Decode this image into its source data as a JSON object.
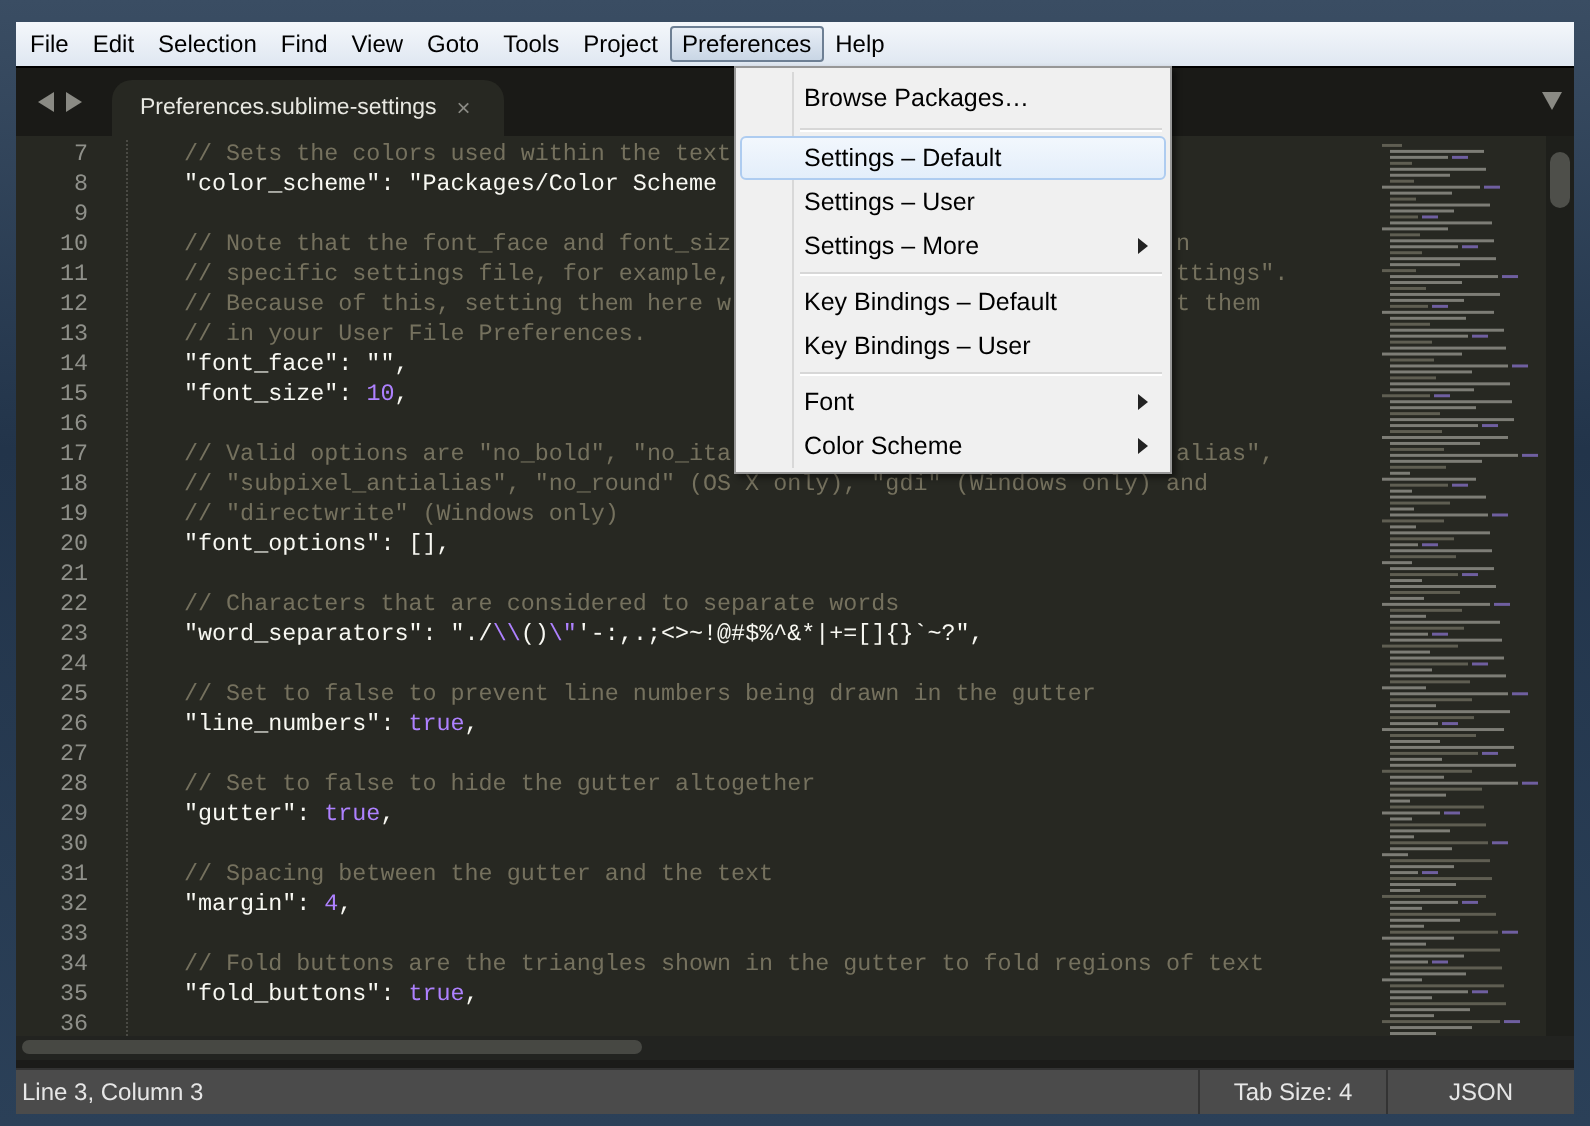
{
  "menu_bar": [
    {
      "label": "File",
      "selected": false
    },
    {
      "label": "Edit",
      "selected": false
    },
    {
      "label": "Selection",
      "selected": false
    },
    {
      "label": "Find",
      "selected": false
    },
    {
      "label": "View",
      "selected": false
    },
    {
      "label": "Goto",
      "selected": false
    },
    {
      "label": "Tools",
      "selected": false
    },
    {
      "label": "Project",
      "selected": false
    },
    {
      "label": "Preferences",
      "selected": true
    },
    {
      "label": "Help",
      "selected": false
    }
  ],
  "tabs": [
    {
      "label": "Preferences.sublime-settings",
      "close": "×",
      "selected": true
    }
  ],
  "dropdown": [
    {
      "kind": "item",
      "label": "Browse Packages…",
      "selected": false,
      "submenu": false
    },
    {
      "kind": "separator"
    },
    {
      "kind": "item",
      "label": "Settings – Default",
      "selected": true,
      "submenu": false
    },
    {
      "kind": "item",
      "label": "Settings – User",
      "selected": false,
      "submenu": false
    },
    {
      "kind": "item",
      "label": "Settings – More",
      "selected": false,
      "submenu": true
    },
    {
      "kind": "separator"
    },
    {
      "kind": "item",
      "label": "Key Bindings – Default",
      "selected": false,
      "submenu": false
    },
    {
      "kind": "item",
      "label": "Key Bindings – User",
      "selected": false,
      "submenu": false
    },
    {
      "kind": "separator"
    },
    {
      "kind": "item",
      "label": "Font",
      "selected": false,
      "submenu": true
    },
    {
      "kind": "item",
      "label": "Color Scheme",
      "selected": false,
      "submenu": true
    }
  ],
  "code_lines": [
    {
      "number": "7",
      "segments": [
        {
          "kind": "comment",
          "text": "// Sets the colors used within the text"
        }
      ]
    },
    {
      "number": "8",
      "segments": [
        {
          "kind": "text",
          "text": "\"color_scheme\": \"Packages/Color Scheme"
        }
      ]
    },
    {
      "number": "9"
    },
    {
      "number": "10",
      "segments": [
        {
          "kind": "comment",
          "text": "// Note that the font_face and font_siz"
        }
      ],
      "tail": "n"
    },
    {
      "number": "11",
      "segments": [
        {
          "kind": "comment",
          "text": "// specific settings file, for example,"
        }
      ],
      "tail": "ttings\"."
    },
    {
      "number": "12",
      "segments": [
        {
          "kind": "comment",
          "text": "// Because of this, setting them here w"
        }
      ],
      "tail": "t them"
    },
    {
      "number": "13",
      "segments": [
        {
          "kind": "comment",
          "text": "// in your User File Preferences."
        }
      ]
    },
    {
      "number": "14",
      "segments": [
        {
          "kind": "text",
          "text": "\"font_face\": \"\","
        }
      ]
    },
    {
      "number": "15",
      "segments": [
        {
          "kind": "text",
          "text": "\"font_size\": "
        },
        {
          "kind": "constant",
          "text": "10"
        },
        {
          "kind": "text",
          "text": ","
        }
      ]
    },
    {
      "number": "16"
    },
    {
      "number": "17",
      "segments": [
        {
          "kind": "comment",
          "text": "// Valid options are \"no_bold\", \"no_ita"
        }
      ],
      "tail": "alias\","
    },
    {
      "number": "18",
      "segments": [
        {
          "kind": "comment",
          "text": "// \"subpixel_antialias\", \"no_round\" (OS X only), \"gdi\" (Windows only) and"
        }
      ]
    },
    {
      "number": "19",
      "segments": [
        {
          "kind": "comment",
          "text": "// \"directwrite\" (Windows only)"
        }
      ]
    },
    {
      "number": "20",
      "segments": [
        {
          "kind": "text",
          "text": "\"font_options\": [],"
        }
      ]
    },
    {
      "number": "21"
    },
    {
      "number": "22",
      "segments": [
        {
          "kind": "comment",
          "text": "// Characters that are considered to separate words"
        }
      ]
    },
    {
      "number": "23",
      "segments": [
        {
          "kind": "text",
          "text": "\"word_separators\": \"./"
        },
        {
          "kind": "constant",
          "text": "\\\\"
        },
        {
          "kind": "text",
          "text": "()"
        },
        {
          "kind": "constant",
          "text": "\\\""
        },
        {
          "kind": "text",
          "text": "'-:,.;<>~!@#$%^&*|+=[]{}`~?\","
        }
      ]
    },
    {
      "number": "24"
    },
    {
      "number": "25",
      "segments": [
        {
          "kind": "comment",
          "text": "// Set to false to prevent line numbers being drawn in the gutter"
        }
      ]
    },
    {
      "number": "26",
      "segments": [
        {
          "kind": "text",
          "text": "\"line_numbers\": "
        },
        {
          "kind": "constant",
          "text": "true"
        },
        {
          "kind": "text",
          "text": ","
        }
      ]
    },
    {
      "number": "27"
    },
    {
      "number": "28",
      "segments": [
        {
          "kind": "comment",
          "text": "// Set to false to hide the gutter altogether"
        }
      ]
    },
    {
      "number": "29",
      "segments": [
        {
          "kind": "text",
          "text": "\"gutter\": "
        },
        {
          "kind": "constant",
          "text": "true"
        },
        {
          "kind": "text",
          "text": ","
        }
      ]
    },
    {
      "number": "30"
    },
    {
      "number": "31",
      "segments": [
        {
          "kind": "comment",
          "text": "// Spacing between the gutter and the text"
        }
      ]
    },
    {
      "number": "32",
      "segments": [
        {
          "kind": "text",
          "text": "\"margin\": "
        },
        {
          "kind": "constant",
          "text": "4"
        },
        {
          "kind": "text",
          "text": ","
        }
      ]
    },
    {
      "number": "33"
    },
    {
      "number": "34",
      "segments": [
        {
          "kind": "comment",
          "text": "// Fold buttons are the triangles shown in the gutter to fold regions of text"
        }
      ]
    },
    {
      "number": "35",
      "segments": [
        {
          "kind": "text",
          "text": "\"fold_buttons\": "
        },
        {
          "kind": "constant",
          "text": "true"
        },
        {
          "kind": "text",
          "text": ","
        }
      ]
    },
    {
      "number": "36"
    }
  ],
  "status_bar": {
    "position": "Line 3, Column 3",
    "tab_size": "Tab Size: 4",
    "syntax": "JSON"
  }
}
